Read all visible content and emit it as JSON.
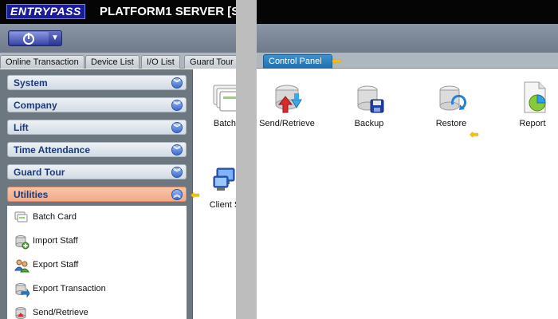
{
  "titlebar": {
    "logo_text": "ENTRYPASS",
    "title": "PLATFORM1 SERVER [S"
  },
  "toolbar": {
    "power_caret": "▼"
  },
  "tabs": [
    {
      "label": "Online Transaction"
    },
    {
      "label": "Device List"
    },
    {
      "label": "I/O List"
    },
    {
      "label": "Guard Tour"
    },
    {
      "label": "Control Panel"
    }
  ],
  "sidebar": {
    "sections": [
      {
        "label": "System",
        "state": "collapsed"
      },
      {
        "label": "Company",
        "state": "collapsed"
      },
      {
        "label": "Lift",
        "state": "collapsed"
      },
      {
        "label": "Time Attendance",
        "state": "collapsed"
      },
      {
        "label": "Guard Tour",
        "state": "collapsed"
      },
      {
        "label": "Utilities",
        "state": "expanded"
      }
    ],
    "utilities_items": [
      {
        "label": "Batch Card",
        "icon": "batch-card-icon"
      },
      {
        "label": "Import Staff",
        "icon": "import-staff-icon"
      },
      {
        "label": "Export Staff",
        "icon": "export-staff-icon"
      },
      {
        "label": "Export Transaction",
        "icon": "export-transaction-icon"
      },
      {
        "label": "Send/Retrieve",
        "icon": "send-retrieve-icon"
      }
    ]
  },
  "panel": {
    "items": [
      {
        "label": "Batch",
        "icon": "batch-card-icon"
      },
      {
        "label": "Send/Retrieve",
        "icon": "send-retrieve-icon"
      },
      {
        "label": "Backup",
        "icon": "backup-icon"
      },
      {
        "label": "Restore",
        "icon": "restore-icon"
      },
      {
        "label": "Report",
        "icon": "report-icon"
      },
      {
        "label": "Client S",
        "icon": "client-icon"
      }
    ]
  },
  "indicators": {
    "arrow_glyph": "⬅"
  },
  "colors": {
    "titlebar": "#050505",
    "active_tab": "#1f6fae",
    "active_section": "#f2a98a",
    "pointer_arrow": "#f2c200"
  }
}
